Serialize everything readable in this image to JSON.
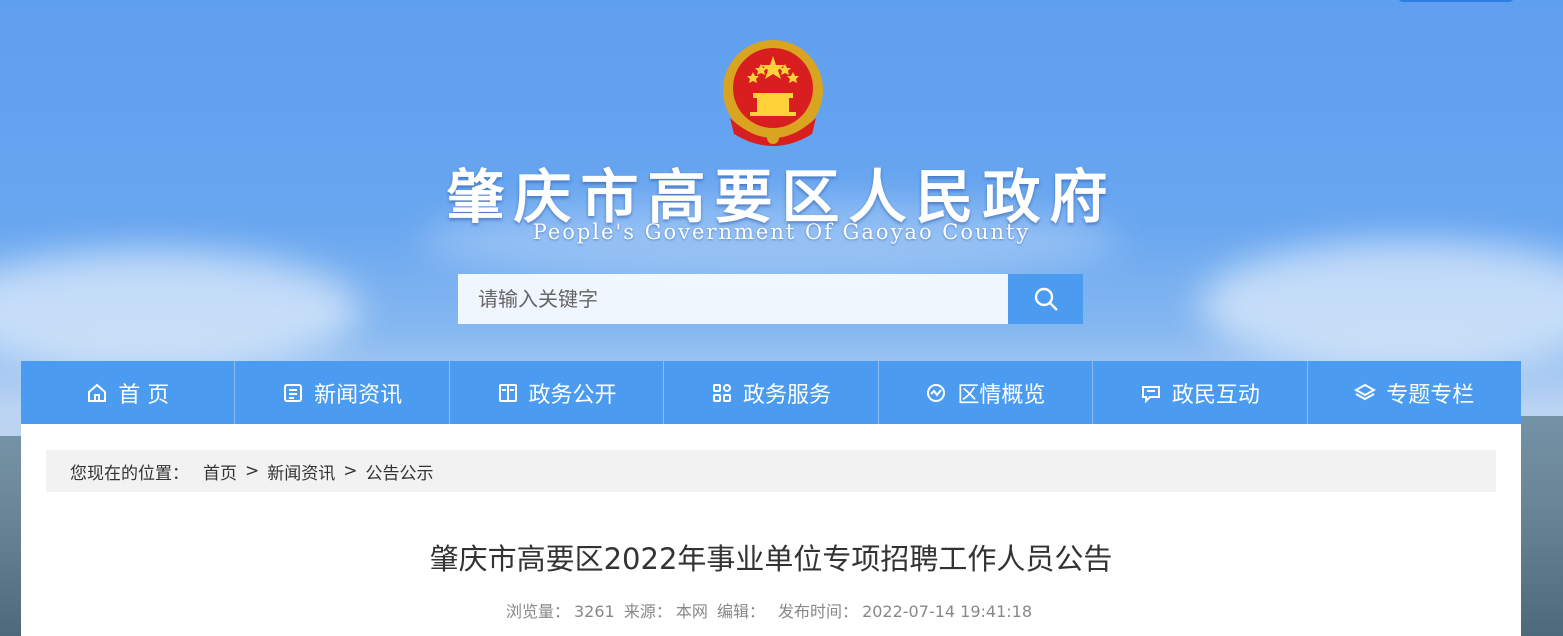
{
  "header": {
    "site_title": "肇庆市高要区人民政府",
    "site_subtitle": "People's Government Of Gaoyao County",
    "emblem": "national-emblem"
  },
  "search": {
    "placeholder": "请输入关键字",
    "button_icon": "search-icon"
  },
  "nav": {
    "items": [
      {
        "label": "首 页",
        "icon": "home-icon"
      },
      {
        "label": "新闻资讯",
        "icon": "news-icon"
      },
      {
        "label": "政务公开",
        "icon": "book-icon"
      },
      {
        "label": "政务服务",
        "icon": "grid-icon"
      },
      {
        "label": "区情概览",
        "icon": "overview-icon"
      },
      {
        "label": "政民互动",
        "icon": "chat-icon"
      },
      {
        "label": "专题专栏",
        "icon": "layers-icon"
      }
    ]
  },
  "breadcrumb": {
    "lead": "您现在的位置：",
    "items": [
      "首页",
      "新闻资讯",
      "公告公示"
    ],
    "separator": ">"
  },
  "article": {
    "title": "肇庆市高要区2022年事业单位专项招聘工作人员公告",
    "meta": {
      "views_label": "浏览量：",
      "views": "3261",
      "source_label": "来源：",
      "source": "本网",
      "editor_label": "编辑：",
      "editor": "",
      "published_label": "发布时间：",
      "published": "2022-07-14 19:41:18"
    }
  },
  "colors": {
    "nav_bg": "#4b9cf0",
    "search_button": "#4b9cf0",
    "breadcrumb_bg": "#f2f2f2"
  }
}
